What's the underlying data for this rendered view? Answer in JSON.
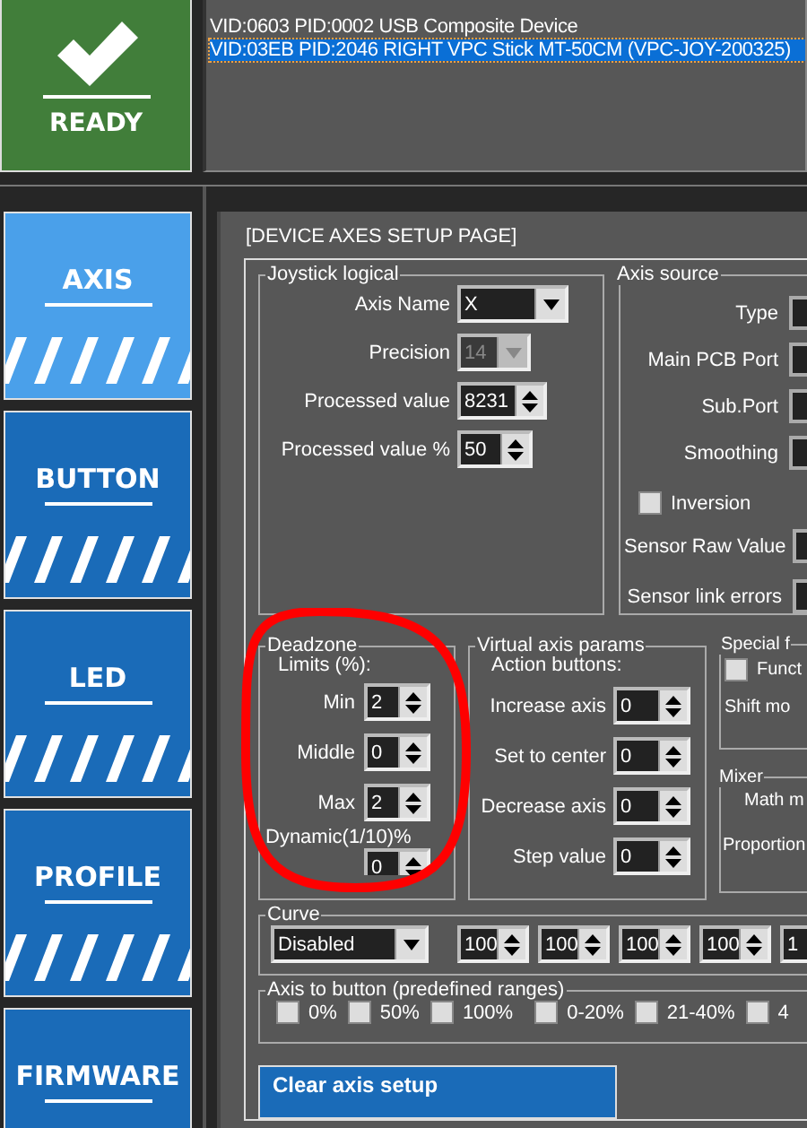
{
  "ready": {
    "label": "READY"
  },
  "devices": [
    {
      "text": "VID:0603 PID:0002 USB Composite Device",
      "selected": false
    },
    {
      "text": "VID:03EB PID:2046 RIGHT VPC Stick MT-50CM (VPC-JOY-200325)",
      "selected": true
    }
  ],
  "nav": [
    {
      "label": "AXIS",
      "selected": true
    },
    {
      "label": "BUTTON",
      "selected": false
    },
    {
      "label": "LED",
      "selected": false
    },
    {
      "label": "PROFILE",
      "selected": false
    },
    {
      "label": "FIRMWARE",
      "selected": false
    }
  ],
  "page_title": "[DEVICE AXES SETUP PAGE]",
  "joystick_logical": {
    "title": "Joystick logical",
    "fields": [
      {
        "label": "Axis Name",
        "kind": "dropdown",
        "value": "X",
        "disabled": false
      },
      {
        "label": "Precision",
        "kind": "dropdown",
        "value": "14",
        "disabled": true
      },
      {
        "label": "Processed value",
        "kind": "spinner",
        "value": "8231"
      },
      {
        "label": "Processed value %",
        "kind": "spinner",
        "value": "50"
      }
    ]
  },
  "axis_source": {
    "title": "Axis source",
    "fields": [
      {
        "label": "Type"
      },
      {
        "label": "Main PCB Port"
      },
      {
        "label": "Sub.Port"
      },
      {
        "label": "Smoothing"
      }
    ],
    "checkboxes": [
      {
        "label": "Inversion",
        "checked": false
      }
    ],
    "readouts": [
      {
        "label": "Sensor Raw Value"
      },
      {
        "label": "Sensor link errors"
      }
    ]
  },
  "deadzone": {
    "title": "Deadzone",
    "subtitle": "Limits (%):",
    "fields": [
      {
        "label": "Min",
        "value": "2"
      },
      {
        "label": "Middle",
        "value": "0"
      },
      {
        "label": "Max",
        "value": "2"
      }
    ],
    "dynamic": {
      "label": "Dynamic(1/10)%",
      "value": "0"
    }
  },
  "virtual_axis": {
    "title": "Virtual axis params",
    "subtitle": "Action buttons:",
    "fields": [
      {
        "label": "Increase axis",
        "value": "0"
      },
      {
        "label": "Set to center",
        "value": "0"
      },
      {
        "label": "Decrease axis",
        "value": "0"
      },
      {
        "label": "Step value",
        "value": "0"
      }
    ]
  },
  "special": {
    "title": "Special f",
    "checkbox": {
      "label": "Funct",
      "checked": false
    },
    "text": "Shift mo"
  },
  "mixer": {
    "title": "Mixer",
    "lines": [
      "Math m",
      "Proportion"
    ]
  },
  "curve": {
    "title": "Curve",
    "mode": "Disabled",
    "values": [
      "100",
      "100",
      "100",
      "100",
      "1"
    ]
  },
  "axis_to_button": {
    "title": "Axis to button (predefined ranges)",
    "options": [
      {
        "label": "0%",
        "checked": false
      },
      {
        "label": "50%",
        "checked": false
      },
      {
        "label": "100%",
        "checked": false
      },
      {
        "label": "0-20%",
        "checked": false
      },
      {
        "label": "21-40%",
        "checked": false
      },
      {
        "label": "4",
        "checked": false
      }
    ]
  },
  "clear_button": {
    "label": "Clear axis setup"
  }
}
